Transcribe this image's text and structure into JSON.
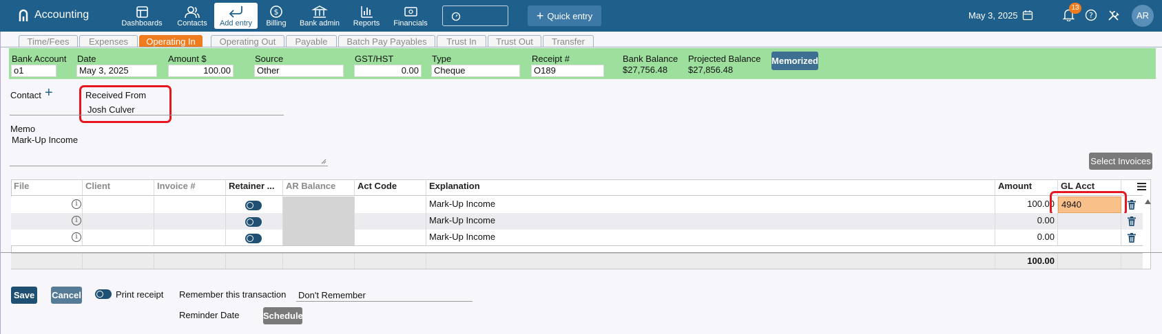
{
  "app": {
    "title": "Accounting"
  },
  "nav": [
    {
      "label": "Dashboards",
      "icon": "dashboard-icon"
    },
    {
      "label": "Contacts",
      "icon": "contacts-icon"
    },
    {
      "label": "Add entry",
      "icon": "return-arrow-icon",
      "active": true
    },
    {
      "label": "Billing",
      "icon": "dollar-icon"
    },
    {
      "label": "Bank admin",
      "icon": "bank-icon"
    },
    {
      "label": "Reports",
      "icon": "bar-chart-icon"
    },
    {
      "label": "Financials",
      "icon": "cash-icon"
    }
  ],
  "quick_entry": "Quick entry",
  "top_date": "May 3, 2025",
  "notification_count": "13",
  "user_initials": "AR",
  "tabs": [
    "Time/Fees",
    "Expenses",
    "Operating In",
    "Operating Out",
    "Payable",
    "Batch Pay Payables",
    "Trust In",
    "Trust Out",
    "Transfer"
  ],
  "active_tab": "Operating In",
  "header_fields": {
    "bank_account": {
      "label": "Bank Account",
      "value": "o1"
    },
    "date": {
      "label": "Date",
      "value": "May 3, 2025"
    },
    "amount": {
      "label": "Amount $",
      "value": "100.00"
    },
    "source": {
      "label": "Source",
      "value": "Other"
    },
    "gst": {
      "label": "GST/HST",
      "value": "0.00"
    },
    "type": {
      "label": "Type",
      "value": "Cheque"
    },
    "receipt": {
      "label": "Receipt #",
      "value": "O189"
    },
    "bank_balance": {
      "label": "Bank Balance",
      "value": "$27,756.48"
    },
    "projected_balance": {
      "label": "Projected Balance",
      "value": "$27,856.48"
    },
    "memorized": "Memorized"
  },
  "contact": {
    "label": "Contact",
    "received_from_label": "Received From",
    "received_from_value": "Josh Culver"
  },
  "memo": {
    "label": "Memo",
    "value": "Mark-Up Income"
  },
  "select_invoices": "Select Invoices",
  "table": {
    "columns": [
      "File",
      "Client",
      "Invoice #",
      "Retainer ...",
      "AR Balance",
      "Act Code",
      "Explanation",
      "Amount",
      "GL Acct"
    ],
    "rows": [
      {
        "explanation": "Mark-Up Income",
        "amount": "100.00",
        "gl_acct": "4940"
      },
      {
        "explanation": "Mark-Up Income",
        "amount": "0.00",
        "gl_acct": ""
      },
      {
        "explanation": "Mark-Up Income",
        "amount": "0.00",
        "gl_acct": ""
      }
    ],
    "total": "100.00"
  },
  "footer": {
    "save": "Save",
    "cancel": "Cancel",
    "print_receipt": "Print receipt",
    "remember_label": "Remember this transaction",
    "remember_value": "Don't Remember",
    "reminder_label": "Reminder Date",
    "schedule": "Schedule"
  }
}
